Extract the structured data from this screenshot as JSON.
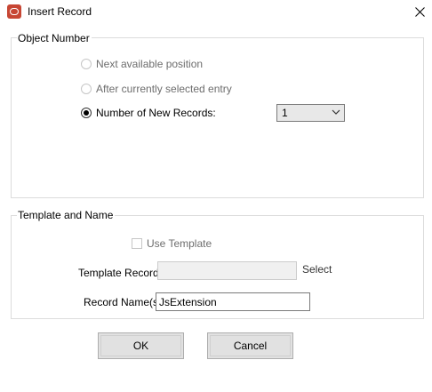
{
  "window": {
    "title": "Insert Record",
    "close_glyph": "close-icon"
  },
  "object_number": {
    "legend": "Object Number",
    "options": [
      {
        "label": "Next available position",
        "checked": false,
        "enabled": false
      },
      {
        "label": "After currently selected entry",
        "checked": false,
        "enabled": false
      },
      {
        "label": "Number of New Records:",
        "checked": true,
        "enabled": true
      }
    ],
    "count_value": "1"
  },
  "template_and_name": {
    "legend": "Template and Name",
    "use_template_label": "Use Template",
    "use_template_checked": false,
    "template_record_label": "Template Record",
    "template_record_value": "",
    "select_label": "Select",
    "record_names_label": "Record Name(s)",
    "record_names_value": "JsExtension"
  },
  "buttons": {
    "ok_label": "OK",
    "cancel_label": "Cancel"
  },
  "colors": {
    "app_icon": "#c74634",
    "button_face": "#e1e1e1",
    "group_border": "#dcdcdc"
  }
}
